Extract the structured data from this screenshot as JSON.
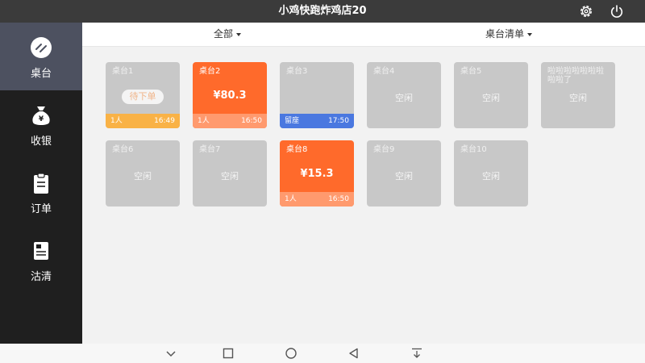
{
  "app": {
    "title": "小鸡快跑炸鸡店20",
    "settings_icon": "gear-icon",
    "power_icon": "power-icon"
  },
  "sidebar": {
    "items": [
      {
        "label": "桌台",
        "icon": "table-icon",
        "active": true
      },
      {
        "label": "收银",
        "icon": "money-bag-icon",
        "active": false
      },
      {
        "label": "订单",
        "icon": "clipboard-icon",
        "active": false
      },
      {
        "label": "沽清",
        "icon": "list-icon",
        "active": false
      }
    ]
  },
  "filters": {
    "area": "全部",
    "table_list": "桌台清单"
  },
  "tables": [
    {
      "name": "桌台1",
      "status": "pending",
      "center": "待下单",
      "people": "1人",
      "time": "16:49"
    },
    {
      "name": "桌台2",
      "status": "busy",
      "amount": "¥80.3",
      "people": "1人",
      "time": "16:50"
    },
    {
      "name": "桌台3",
      "status": "reserved",
      "footer_label": "留座",
      "time": "17:50"
    },
    {
      "name": "桌台4",
      "status": "idle",
      "center": "空闲"
    },
    {
      "name": "桌台5",
      "status": "idle",
      "center": "空闲"
    },
    {
      "name": "啦啦啦啦啦啦啦啦啦了",
      "status": "idle",
      "center": "空闲"
    },
    {
      "name": "桌台6",
      "status": "idle",
      "center": "空闲"
    },
    {
      "name": "桌台7",
      "status": "idle",
      "center": "空闲"
    },
    {
      "name": "桌台8",
      "status": "busy",
      "amount": "¥15.3",
      "people": "1人",
      "time": "16:50"
    },
    {
      "name": "桌台9",
      "status": "idle",
      "center": "空闲"
    },
    {
      "name": "桌台10",
      "status": "idle",
      "center": "空闲"
    }
  ],
  "colors": {
    "busy": "#ff6a2b",
    "idle": "#c8c8c8",
    "pending_footer": "#f9b246",
    "reserved_footer": "#4a78e0",
    "sidebar_active": "#4d5160"
  }
}
